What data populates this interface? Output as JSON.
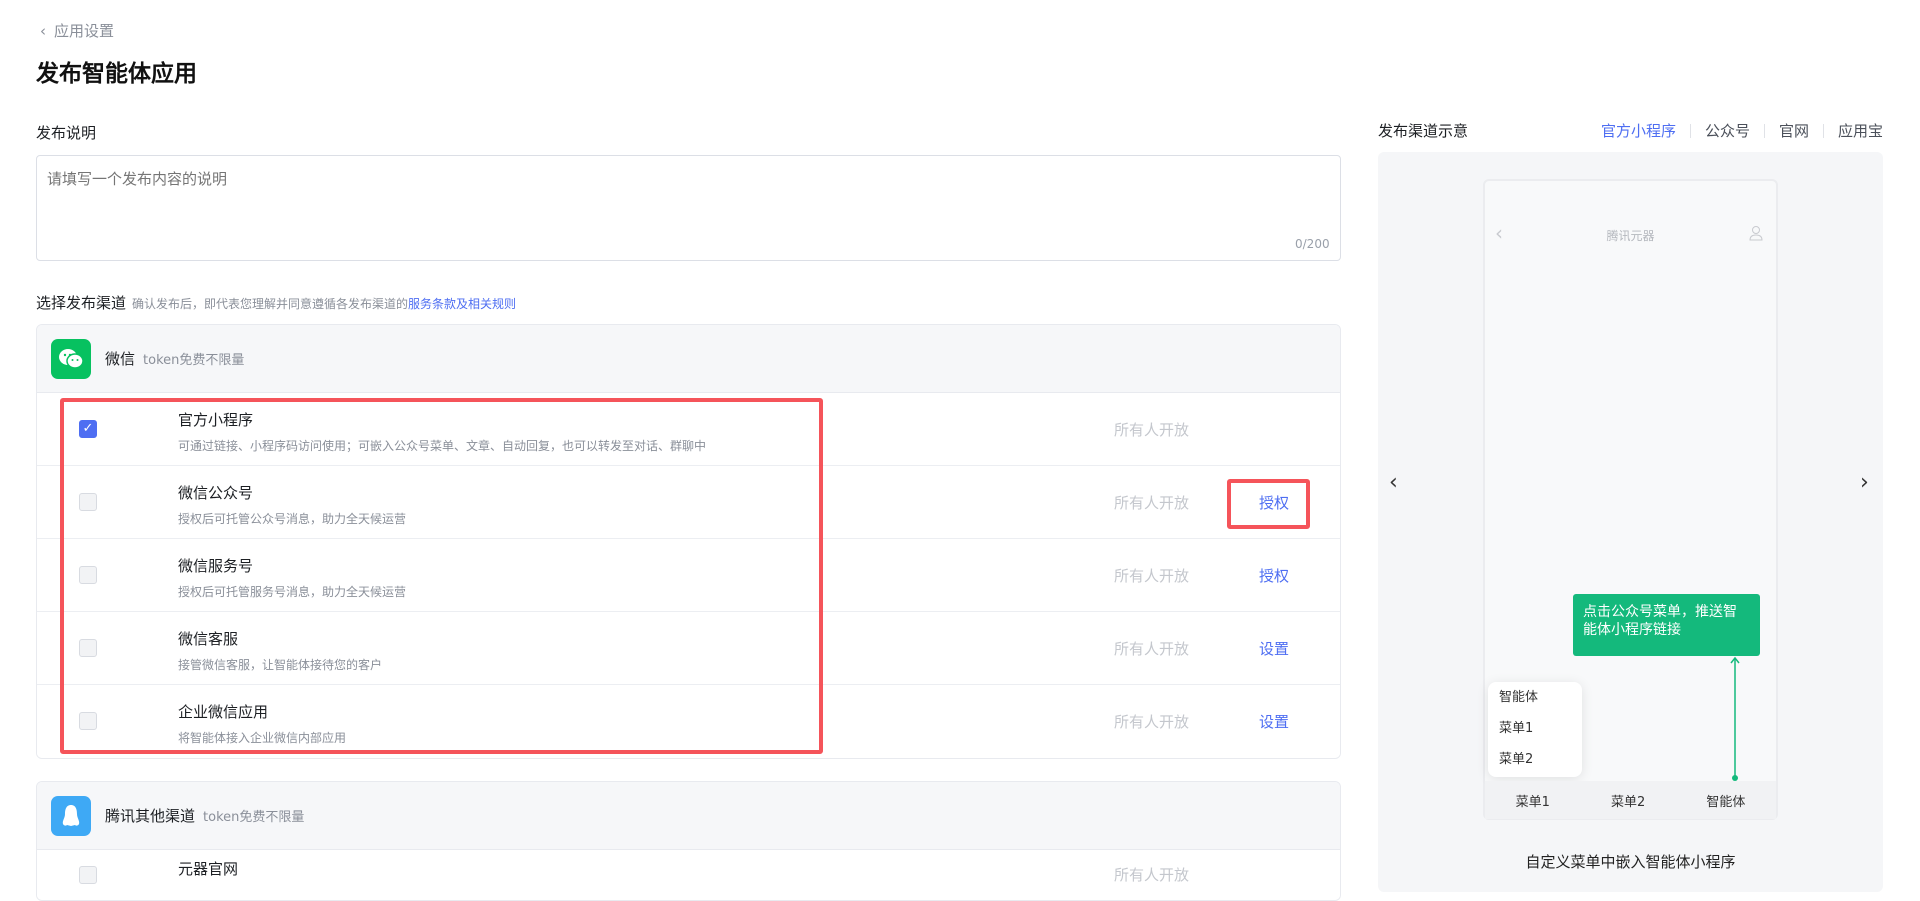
{
  "header": {
    "back_label": "应用设置",
    "title": "发布智能体应用"
  },
  "description": {
    "label": "发布说明",
    "placeholder": "请填写一个发布内容的说明",
    "counter": "0/200"
  },
  "channels": {
    "label": "选择发布渠道",
    "hint": "确认发布后，即代表您理解并同意遵循各发布渠道的",
    "terms_link": "服务条款及相关规则",
    "groups": [
      {
        "name": "微信",
        "sub": "token免费不限量",
        "color": "#07c160",
        "rows": [
          {
            "title": "官方小程序",
            "desc": "可通过链接、小程序码访问使用；可嵌入公众号菜单、文章、自动回复，也可以转发至对话、群聊中",
            "openness": "所有人开放",
            "action": "",
            "checked": true
          },
          {
            "title": "微信公众号",
            "desc": "授权后可托管公众号消息，助力全天候运营",
            "openness": "所有人开放",
            "action": "授权",
            "checked": false
          },
          {
            "title": "微信服务号",
            "desc": "授权后可托管服务号消息，助力全天候运营",
            "openness": "所有人开放",
            "action": "授权",
            "checked": false
          },
          {
            "title": "微信客服",
            "desc": "接管微信客服，让智能体接待您的客户",
            "openness": "所有人开放",
            "action": "设置",
            "checked": false
          },
          {
            "title": "企业微信应用",
            "desc": "将智能体接入企业微信内部应用",
            "openness": "所有人开放",
            "action": "设置",
            "checked": false
          }
        ]
      },
      {
        "name": "腾讯其他渠道",
        "sub": "token免费不限量",
        "color": "#3ea9f5",
        "rows": [
          {
            "title": "元器官网",
            "openness": "所有人开放"
          }
        ]
      }
    ]
  },
  "preview": {
    "label": "发布渠道示意",
    "tabs": [
      "官方小程序",
      "公众号",
      "官网",
      "应用宝"
    ],
    "active_tab": "官方小程序",
    "phone_title": "腾讯元器",
    "callout": "点击公众号菜单，推送智能体小程序链接",
    "popup_items": [
      "智能体",
      "菜单1",
      "菜单2"
    ],
    "bottom_menu": [
      "菜单1",
      "菜单2",
      "智能体"
    ],
    "caption": "自定义菜单中嵌入智能体小程序",
    "accent": "#4e6ef2",
    "green": "#14b97c"
  }
}
